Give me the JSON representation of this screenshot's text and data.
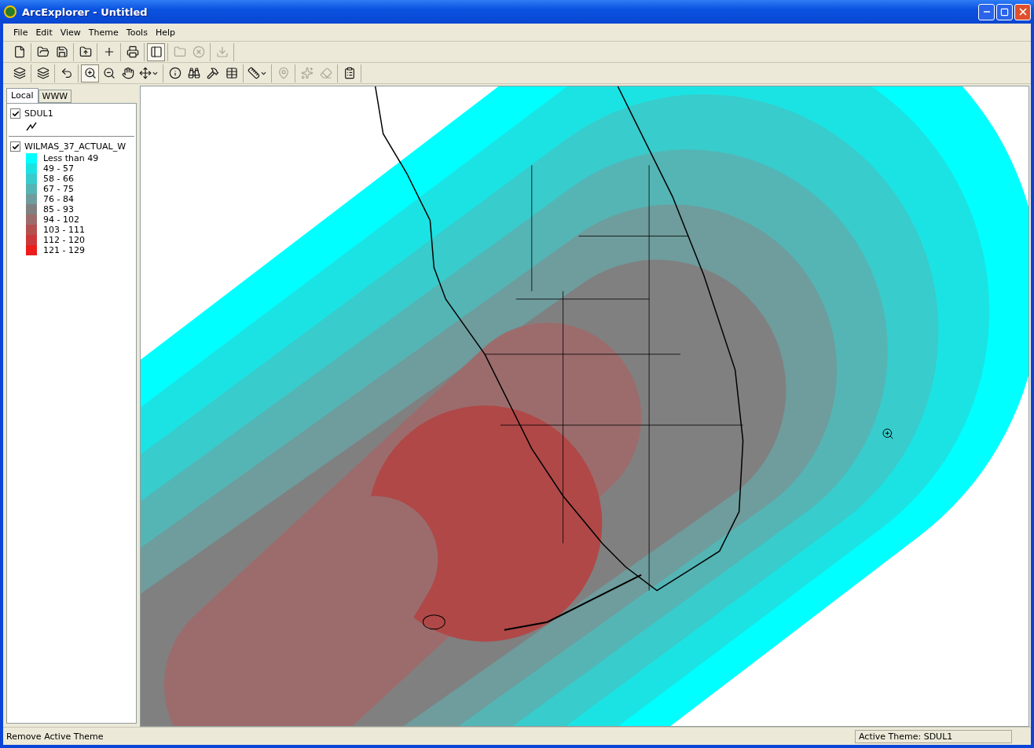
{
  "window": {
    "title": "ArcExplorer - Untitled"
  },
  "menu": [
    "File",
    "Edit",
    "View",
    "Theme",
    "Tools",
    "Help"
  ],
  "toolbars": [
    {
      "groups": [
        [
          {
            "pressed": false,
            "disabled": false,
            "dropdown": false
          }
        ],
        [
          {
            "pressed": false,
            "disabled": false,
            "dropdown": false
          },
          {
            "pressed": false,
            "disabled": false,
            "dropdown": false
          }
        ],
        [
          {
            "pressed": false,
            "disabled": false,
            "dropdown": false
          }
        ],
        [
          {
            "pressed": false,
            "disabled": false,
            "dropdown": false
          }
        ],
        [
          {
            "pressed": false,
            "disabled": false,
            "dropdown": false
          }
        ],
        [
          {
            "pressed": true,
            "disabled": false,
            "dropdown": false
          }
        ],
        [
          {
            "pressed": false,
            "disabled": true,
            "dropdown": false
          },
          {
            "pressed": false,
            "disabled": true,
            "dropdown": false
          }
        ],
        [
          {
            "pressed": false,
            "disabled": true,
            "dropdown": false
          }
        ]
      ]
    },
    {
      "groups": [
        [
          {
            "pressed": false,
            "disabled": false,
            "dropdown": false
          }
        ],
        [
          {
            "pressed": false,
            "disabled": false,
            "dropdown": false
          }
        ],
        [
          {
            "pressed": false,
            "disabled": false,
            "dropdown": false
          }
        ],
        [
          {
            "pressed": true,
            "disabled": false,
            "dropdown": false
          },
          {
            "pressed": false,
            "disabled": false,
            "dropdown": false
          },
          {
            "pressed": false,
            "disabled": false,
            "dropdown": false
          },
          {
            "pressed": false,
            "disabled": false,
            "dropdown": true
          }
        ],
        [
          {
            "pressed": false,
            "disabled": false,
            "dropdown": false
          },
          {
            "pressed": false,
            "disabled": false,
            "dropdown": false
          },
          {
            "pressed": false,
            "disabled": false,
            "dropdown": false
          },
          {
            "pressed": false,
            "disabled": false,
            "dropdown": false
          }
        ],
        [
          {
            "pressed": false,
            "disabled": false,
            "dropdown": true
          }
        ],
        [
          {
            "pressed": false,
            "disabled": true,
            "dropdown": false
          }
        ],
        [
          {
            "pressed": false,
            "disabled": true,
            "dropdown": false
          },
          {
            "pressed": false,
            "disabled": true,
            "dropdown": false
          }
        ],
        [
          {
            "pressed": false,
            "disabled": false,
            "dropdown": false
          }
        ]
      ]
    }
  ],
  "tabs": [
    {
      "label": "Local",
      "selected": true
    },
    {
      "label": "WWW",
      "selected": false
    }
  ],
  "layers": [
    {
      "name": "SDUL1",
      "checked": true,
      "kind": "lines"
    },
    {
      "name": "WILMAS_37_ACTUAL_W",
      "checked": true,
      "kind": "classes",
      "classes": [
        {
          "label": "Less than 49",
          "color": "#00ffff"
        },
        {
          "label": "49 - 57",
          "color": "#1ce3e3"
        },
        {
          "label": "58 - 66",
          "color": "#38cccc"
        },
        {
          "label": "67 - 75",
          "color": "#55b5b5"
        },
        {
          "label": "76 - 84",
          "color": "#6f9c9c"
        },
        {
          "label": "85 - 93",
          "color": "#808080"
        },
        {
          "label": "94 - 102",
          "color": "#9c6c6c"
        },
        {
          "label": "103 - 111",
          "color": "#b45050"
        },
        {
          "label": "112 - 120",
          "color": "#cc3838"
        },
        {
          "label": "121 - 129",
          "color": "#ea1c1c"
        }
      ]
    }
  ],
  "status_bar": {
    "message": "Remove Active Theme",
    "active_theme": "Active Theme: SDUL1"
  }
}
